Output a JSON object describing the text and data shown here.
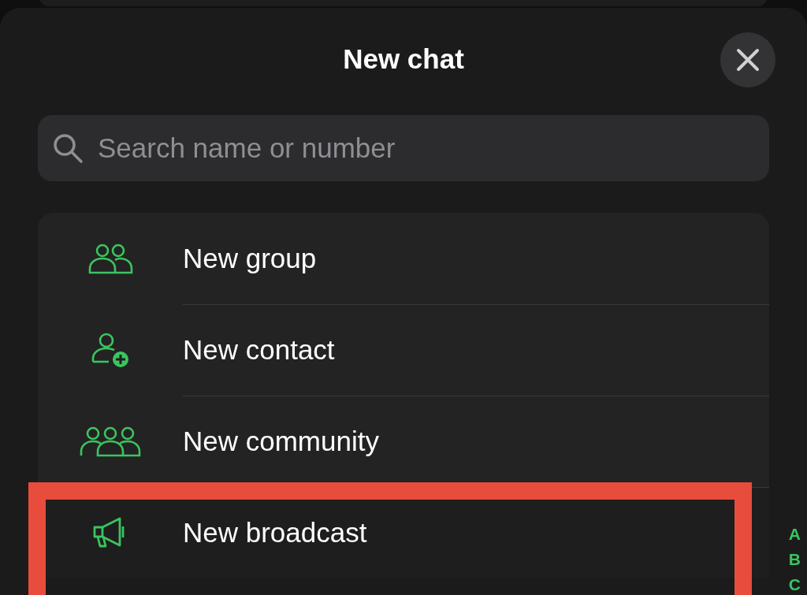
{
  "sheet": {
    "title": "New chat"
  },
  "search": {
    "placeholder": "Search name or number"
  },
  "actions": [
    {
      "kind": "group",
      "label": "New group",
      "highlighted": false
    },
    {
      "kind": "contact",
      "label": "New contact",
      "highlighted": false
    },
    {
      "kind": "community",
      "label": "New community",
      "highlighted": false
    },
    {
      "kind": "broadcast",
      "label": "New broadcast",
      "highlighted": true
    }
  ],
  "index_letters": [
    "A",
    "B",
    "C"
  ]
}
